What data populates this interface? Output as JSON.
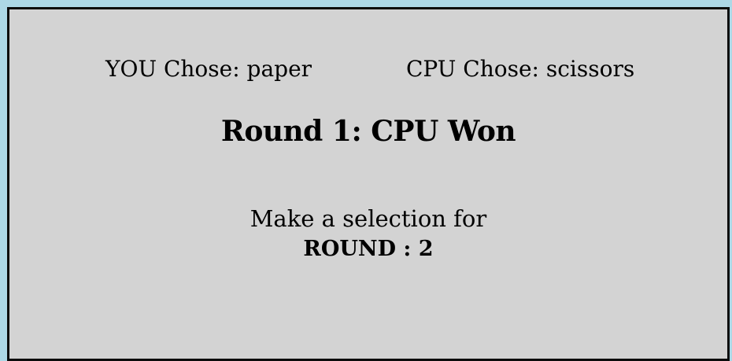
{
  "colors": {
    "page_background": "#add8e6",
    "panel_background": "#d3d3d3",
    "panel_border": "#0b0b0b",
    "text": "#000000"
  },
  "choices": {
    "you": "YOU Chose: paper",
    "cpu": "CPU Chose: scissors"
  },
  "result": {
    "text": "Round 1: CPU Won"
  },
  "prompt": {
    "line1": "Make a selection for",
    "line2": "ROUND : 2"
  }
}
